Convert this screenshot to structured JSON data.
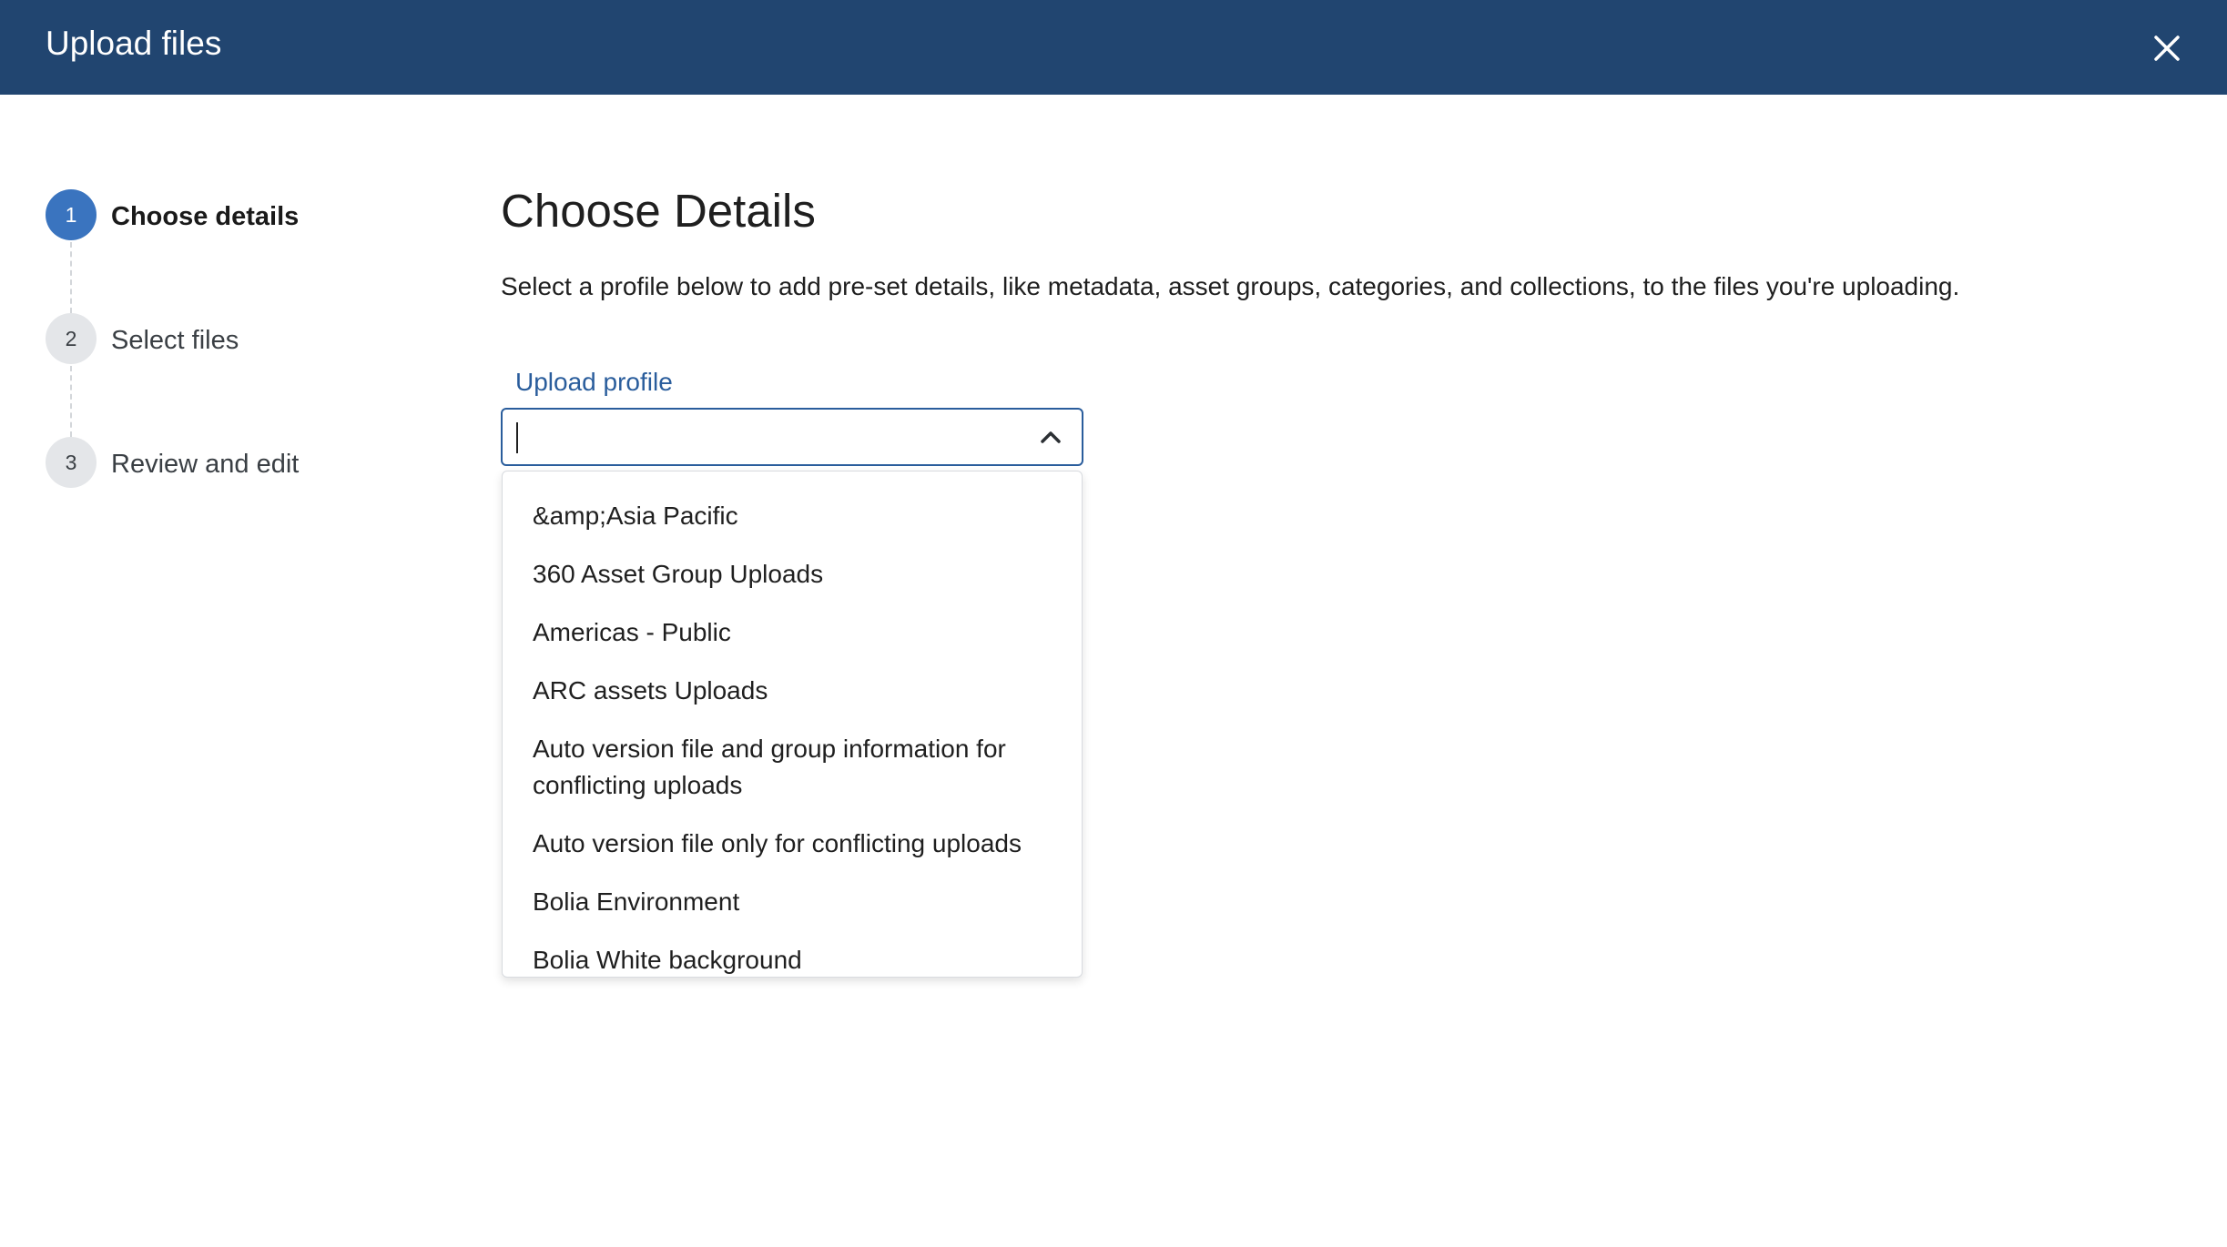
{
  "header": {
    "title": "Upload files",
    "close_icon": "close-icon"
  },
  "stepper": {
    "steps": [
      {
        "number": "1",
        "label": "Choose details",
        "active": true
      },
      {
        "number": "2",
        "label": "Select files",
        "active": false
      },
      {
        "number": "3",
        "label": "Review and edit",
        "active": false
      }
    ]
  },
  "main": {
    "title": "Choose Details",
    "description": "Select a profile below to add pre-set details, like metadata, asset groups, categories, and collections, to the files you're uploading.",
    "upload_profile": {
      "label": "Upload profile",
      "value": "",
      "expanded": true,
      "chevron_icon": "chevron-up-icon",
      "options": [
        "&amp;Asia Pacific",
        "360 Asset Group Uploads",
        "Americas - Public",
        "ARC assets Uploads",
        "Auto version file and group information for conflicting uploads",
        "Auto version file only for conflicting uploads",
        "Bolia Environment",
        "Bolia White background"
      ]
    }
  },
  "colors": {
    "header_bg": "#214570",
    "accent": "#2a5d9c",
    "active_step": "#3a74bf"
  }
}
